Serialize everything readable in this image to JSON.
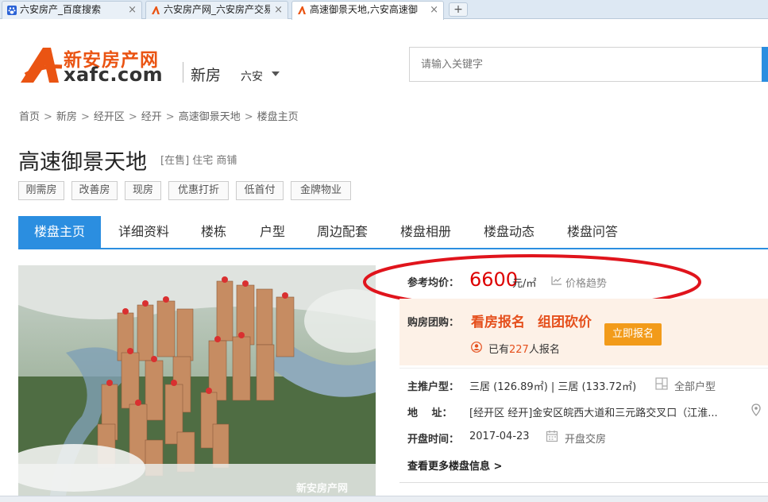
{
  "browser": {
    "tabs": [
      {
        "title": "六安房产_百度搜索",
        "close": "×",
        "active": false
      },
      {
        "title": "六安房产网_六安房产交易",
        "close": "×",
        "active": false
      },
      {
        "title": "高速御景天地,六安高速御",
        "close": "×",
        "active": true
      }
    ],
    "new_tab": "+"
  },
  "header": {
    "logo_cn": "新安房产网",
    "logo_en": "xafc.com",
    "section": "新房",
    "city": "六安",
    "search_placeholder": "请输入关键字"
  },
  "breadcrumb": [
    "首页",
    "新房",
    "经开区",
    "经开",
    "高速御景天地",
    "楼盘主页"
  ],
  "breadcrumb_sep": ">",
  "project": {
    "title": "高速御景天地",
    "status": "[在售] 住宅 商铺",
    "tags": [
      "刚需房",
      "改善房",
      "现房",
      "优惠打折",
      "低首付",
      "金牌物业"
    ]
  },
  "nav": [
    "楼盘主页",
    "详细资料",
    "楼栋",
    "户型",
    "周边配套",
    "楼盘相册",
    "楼盘动态",
    "楼盘问答"
  ],
  "price": {
    "label": "参考均价：",
    "value": "6600",
    "unit": "元/㎡",
    "trend": "价格趋势"
  },
  "group_buy": {
    "label": "购房团购：",
    "link1": "看房报名",
    "link2": "组团砍价",
    "count_prefix": "已有",
    "count": "227",
    "count_suffix": "人报名",
    "button": "立即报名"
  },
  "info": {
    "layout_label": "主推户型：",
    "layout_value": "三居 (126.89㎡) | 三居 (133.72㎡)",
    "layout_all": "全部户型",
    "address_label": "地　 址：",
    "address_value": "[经开区 经开]金安区皖西大道和三元路交叉口（江淮...",
    "open_label": "开盘时间：",
    "open_value": "2017-04-23",
    "open_link": "开盘交房",
    "more": "查看更多楼盘信息 >"
  },
  "watermark": "新安房产网",
  "colors": {
    "accent": "#2b8ee0",
    "price": "#dd0000",
    "brand": "#ea5413",
    "button": "#f29b1a"
  }
}
